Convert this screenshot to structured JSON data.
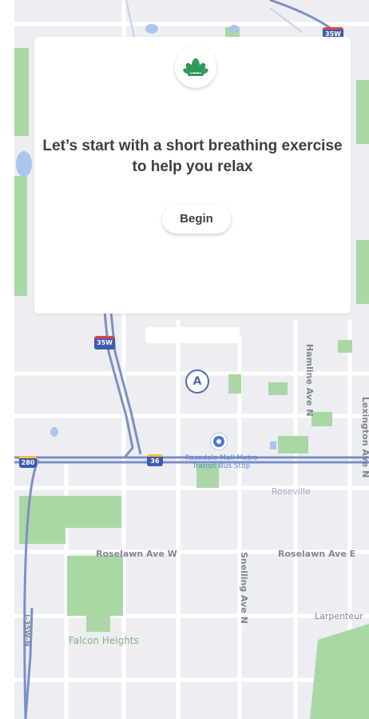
{
  "card": {
    "icon": "lotus-icon",
    "message": "Let’s start with a short breathing exercise to help you relax",
    "begin_label": "Begin"
  },
  "map": {
    "marker_label": "A",
    "streets": {
      "hamline": "Hamline Ave N",
      "lexington": "Lexington Ave N",
      "snelling": "Snelling Ave N",
      "roselawn_w": "Roselawn Ave W",
      "roselawn_e": "Roselawn Ave E",
      "larpenteur": "Larpenteur",
      "i35w": "I-35W-N"
    },
    "places": {
      "roseville": "Roseville",
      "falcon_heights": "Falcon Heights",
      "transit": "Rosedale Mall Metro Transit Bus Stop"
    },
    "shields": {
      "i35w_top": "35W",
      "i35w_mid": "35W",
      "hwy280": "280",
      "hwy36": "36"
    }
  },
  "colors": {
    "map_bg": "#eceef2",
    "park_green": "#a9d8a4",
    "water_blue": "#a8c6ee",
    "road_blue": "#7d8fc8",
    "accent_green": "#2f9a5a"
  }
}
